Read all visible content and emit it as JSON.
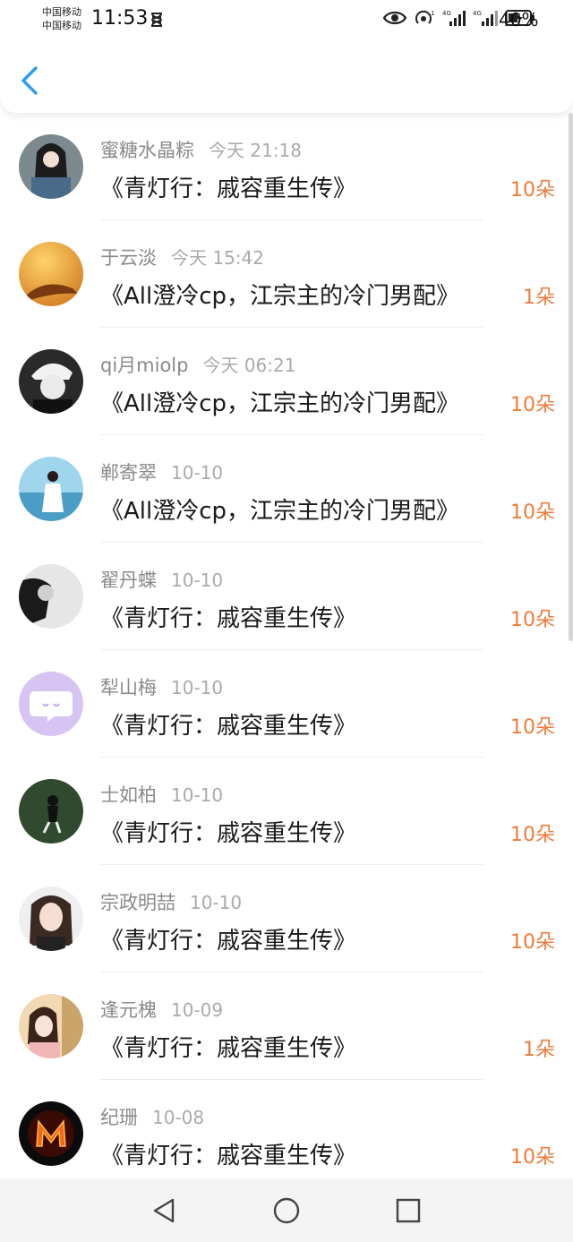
{
  "status_bar": {
    "carrier_1": "中国移动",
    "carrier_2": "中国移动",
    "time": "11:53",
    "battery": "40%"
  },
  "header": {
    "back_icon": "chevron-left-icon",
    "accent_color": "#2a9df4"
  },
  "list": {
    "flower_color": "#f07a3a",
    "items": [
      {
        "name": "蜜糖水晶粽",
        "time": "今天 21:18",
        "title": "《青灯行：戚容重生传》",
        "flowers": "10朵"
      },
      {
        "name": "于云淡",
        "time": "今天 15:42",
        "title": "《All澄冷cp，江宗主的冷门男配》",
        "flowers": "1朵"
      },
      {
        "name": "qi月miolp",
        "time": "今天 06:21",
        "title": "《All澄冷cp，江宗主的冷门男配》",
        "flowers": "10朵"
      },
      {
        "name": "郸寄翠",
        "time": "10-10",
        "title": "《All澄冷cp，江宗主的冷门男配》",
        "flowers": "10朵"
      },
      {
        "name": "翟丹蝶",
        "time": "10-10",
        "title": "《青灯行：戚容重生传》",
        "flowers": "10朵"
      },
      {
        "name": "犁山梅",
        "time": "10-10",
        "title": "《青灯行：戚容重生传》",
        "flowers": "10朵"
      },
      {
        "name": "士如柏",
        "time": "10-10",
        "title": "《青灯行：戚容重生传》",
        "flowers": "10朵"
      },
      {
        "name": "宗政明喆",
        "time": "10-10",
        "title": "《青灯行：戚容重生传》",
        "flowers": "10朵"
      },
      {
        "name": "逢元槐",
        "time": "10-09",
        "title": "《青灯行：戚容重生传》",
        "flowers": "1朵"
      },
      {
        "name": "纪珊",
        "time": "10-08",
        "title": "《青灯行：戚容重生传》",
        "flowers": "10朵"
      }
    ]
  },
  "nav_bar": {
    "back_icon": "triangle-back-icon",
    "home_icon": "circle-home-icon",
    "recents_icon": "square-recents-icon"
  }
}
